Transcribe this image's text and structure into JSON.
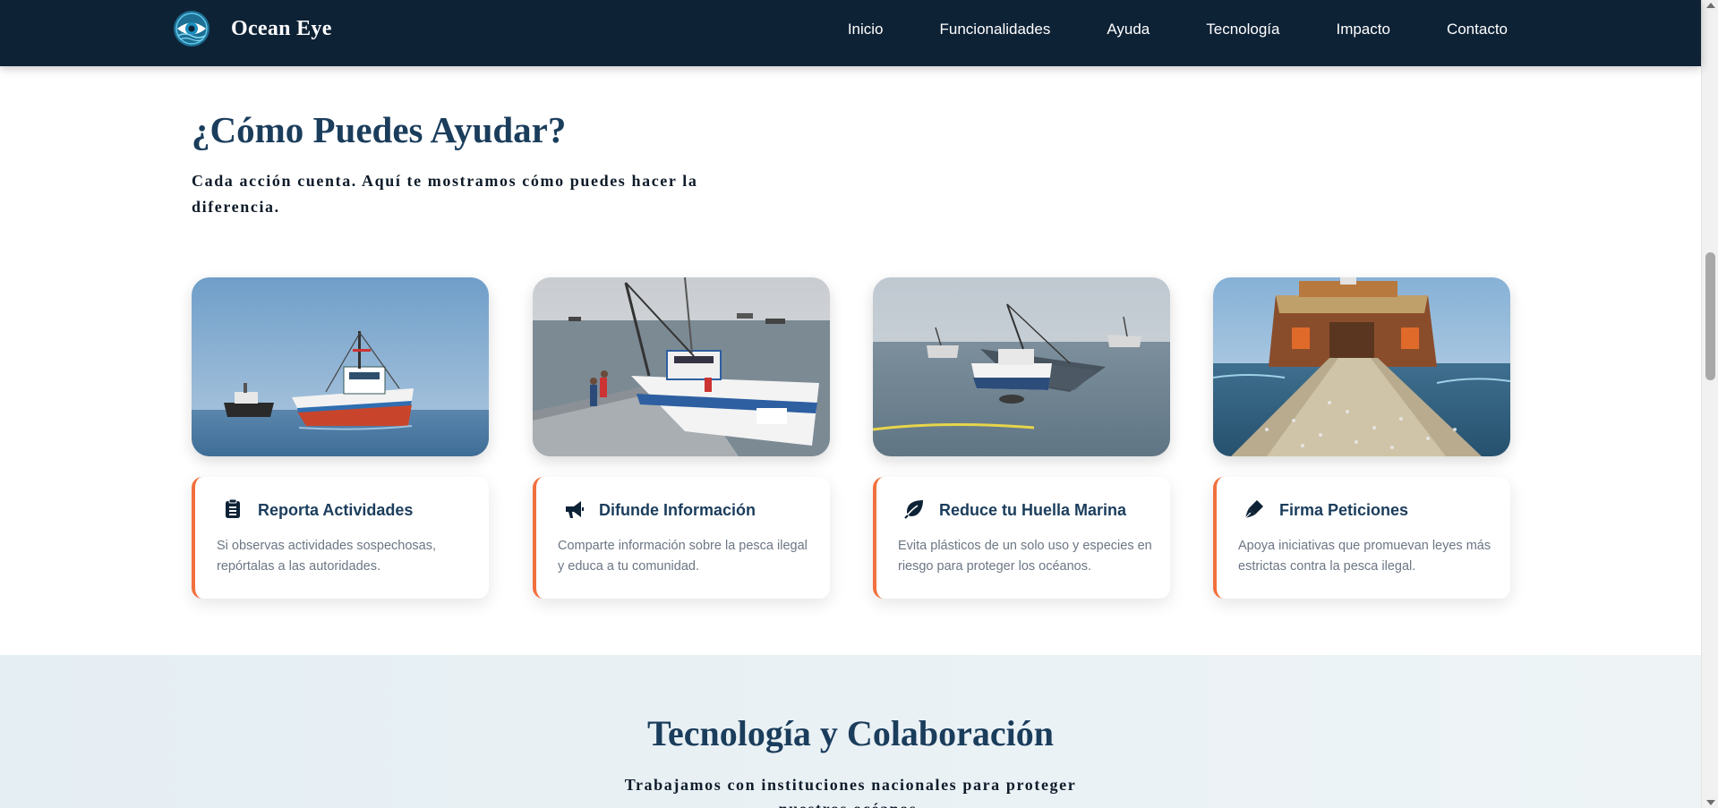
{
  "brand": {
    "name": "Ocean Eye",
    "logo_icon": "eye-logo-icon"
  },
  "nav": {
    "items": [
      {
        "label": "Inicio"
      },
      {
        "label": "Funcionalidades"
      },
      {
        "label": "Ayuda"
      },
      {
        "label": "Tecnología"
      },
      {
        "label": "Impacto"
      },
      {
        "label": "Contacto"
      }
    ]
  },
  "help": {
    "title": "¿Cómo Puedes Ayudar?",
    "subtitle": "Cada acción cuenta. Aquí te mostramos cómo puedes hacer la diferencia.",
    "cards": [
      {
        "title": "Reporta Actividades",
        "description": "Si observas actividades sospechosas, repórtalas a las autoridades.",
        "icon": "clipboard-icon",
        "image": "fishing-boat-photo"
      },
      {
        "title": "Difunde Información",
        "description": "Comparte información sobre la pesca ilegal y educa a tu comunidad.",
        "icon": "megaphone-icon",
        "image": "harbor-boat-photo"
      },
      {
        "title": "Reduce tu Huella Marina",
        "description": "Evita plásticos de un solo uso y especies en riesgo para proteger los océanos.",
        "icon": "leaf-icon",
        "image": "fishing-nets-photo"
      },
      {
        "title": "Firma Peticiones",
        "description": "Apoya iniciativas que promuevan leyes más estrictas contra la pesca ilegal.",
        "icon": "pen-icon",
        "image": "trawler-net-photo"
      }
    ]
  },
  "tech": {
    "title": "Tecnología y Colaboración",
    "subtitle": "Trabajamos con instituciones nacionales para proteger nuestros océanos."
  },
  "colors": {
    "navbar": "#0e2236",
    "heading": "#1b3d5c",
    "accent": "#f2703e",
    "body_text": "#6c7684",
    "section_bg": "#e9f1f4"
  }
}
